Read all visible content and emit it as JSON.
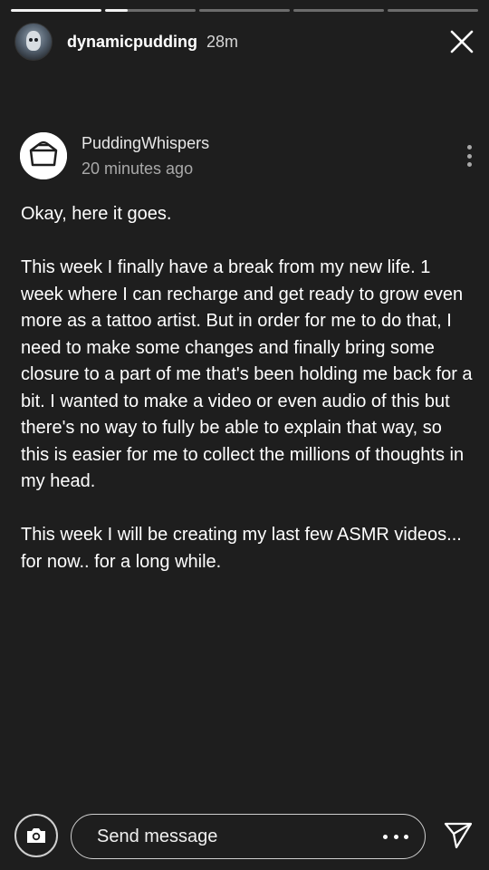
{
  "story": {
    "progress": [
      1.0,
      0.25,
      0,
      0,
      0
    ],
    "username": "dynamicpudding",
    "time_ago": "28m",
    "avatar_icon": "avatar-icon"
  },
  "post": {
    "author": "PuddingWhispers",
    "timestamp": "20 minutes ago",
    "paragraphs": [
      "Okay, here it goes.",
      "This week I finally have a break from my new life. 1 week where I can recharge and get ready to grow even more as a tattoo artist. But in order for me to do that,  I need to make some changes and finally bring some closure to a part of me that's been holding me back for a bit. I wanted to make a video or even audio of this but there's no way to fully be able to explain that way, so this is easier for me to collect the millions of thoughts in my head.",
      "This week I will be creating my last few ASMR videos... for now.. for a long while."
    ]
  },
  "composer": {
    "placeholder": "Send message",
    "value": ""
  },
  "colors": {
    "background": "#1e1e1e",
    "text": "#ffffff",
    "muted": "#a9a9a9"
  }
}
